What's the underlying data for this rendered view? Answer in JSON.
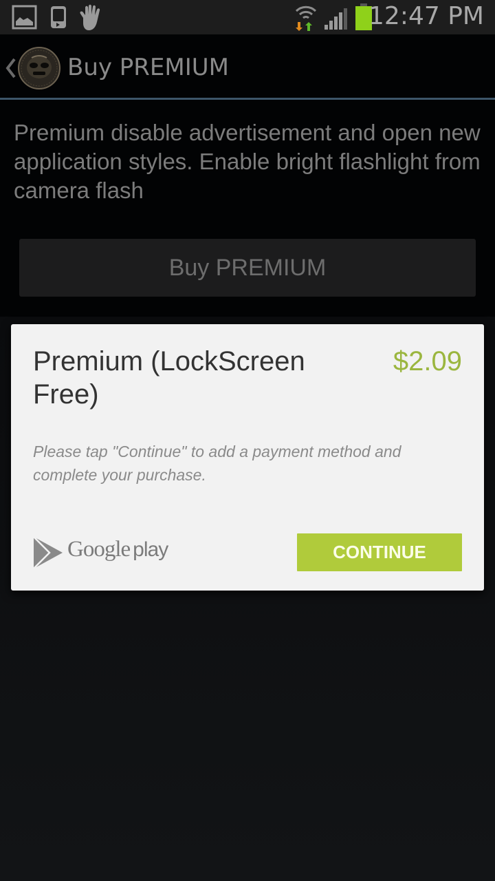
{
  "status_bar": {
    "left_icons": [
      "gallery-icon",
      "media-player-icon",
      "hand-gesture-icon"
    ],
    "right_icons": [
      "wifi-data-activity-icon",
      "signal-strength-icon",
      "battery-icon"
    ],
    "time": "12:47 PM",
    "battery_color": "#8fd11a"
  },
  "action_bar": {
    "back_icon": "chevron-left-icon",
    "app_icon": "tribal-mask-logo",
    "title": "Buy PREMIUM",
    "divider_color": "#3d5569"
  },
  "main": {
    "description": "Premium disable advertisement and open new application styles. Enable bright flashlight from camera flash",
    "buy_button_label": "Buy PREMIUM"
  },
  "purchase_dialog": {
    "product_name": "Premium (LockScreen Free)",
    "price": "$2.09",
    "price_color": "#9bb63f",
    "note": "Please tap \"Continue\" to add a payment method and complete your purchase.",
    "brand_logo": {
      "icon": "google-play-triangle-icon",
      "word1": "Google",
      "word2": "play"
    },
    "continue_button_label": "CONTINUE",
    "continue_button_color": "#b0cb3b"
  }
}
